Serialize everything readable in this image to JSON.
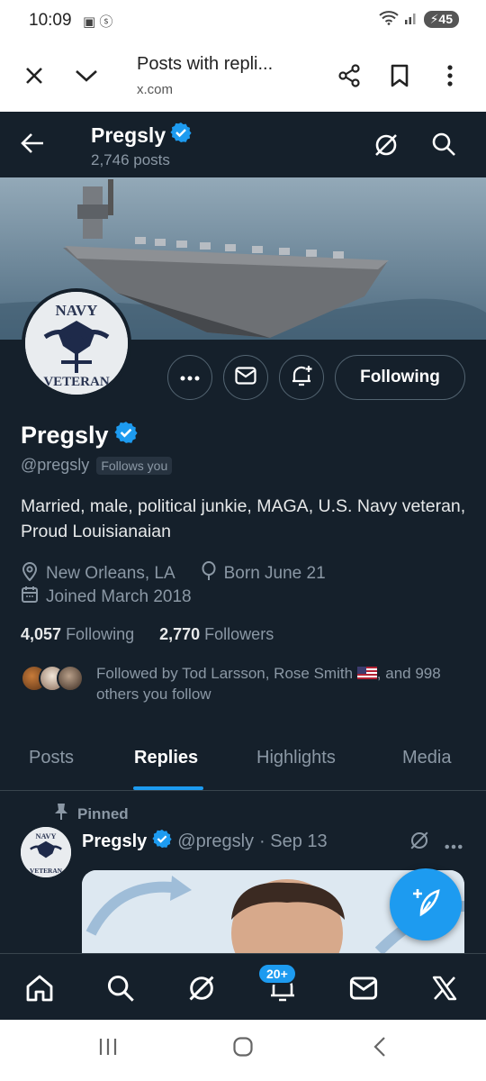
{
  "status_bar": {
    "time": "10:09",
    "battery": "45"
  },
  "browser": {
    "title": "Posts with repli...",
    "url": "x.com"
  },
  "header": {
    "name": "Pregsly",
    "posts_count": "2,746 posts"
  },
  "profile": {
    "name": "Pregsly",
    "handle": "@pregsly",
    "follows_you": "Follows you",
    "bio": "Married, male, political junkie, MAGA, U.S. Navy veteran, Proud Louisianaian",
    "location": "New Orleans, LA",
    "birthday": "Born June 21",
    "joined": "Joined March 2018",
    "following_count": "4,057",
    "following_label": "Following",
    "followers_count": "2,770",
    "followers_label": "Followers",
    "followed_by_prefix": "Followed by Tod Larsson, Rose Smith",
    "followed_by_suffix": ", and 998 others you follow",
    "follow_button": "Following",
    "avatar_text_top": "NAVY",
    "avatar_text_bottom": "VETERAN"
  },
  "tabs": [
    {
      "label": "Posts",
      "active": false
    },
    {
      "label": "Replies",
      "active": true
    },
    {
      "label": "Highlights",
      "active": false
    },
    {
      "label": "Media",
      "active": false
    }
  ],
  "post": {
    "pinned_label": "Pinned",
    "author": "Pregsly",
    "handle": "@pregsly",
    "date": "· Sep 13"
  },
  "bottom_nav": {
    "notifications_badge": "20+"
  },
  "colors": {
    "background": "#15202b",
    "accent": "#1d9bf0",
    "muted": "#8b98a5",
    "border": "#536471"
  },
  "icons": [
    "close-icon",
    "chevron-down-icon",
    "share-icon",
    "bookmark-icon",
    "more-vertical-icon",
    "back-arrow-icon",
    "verified-badge-icon",
    "grok-icon",
    "search-icon",
    "more-horizontal-icon",
    "mail-icon",
    "bell-plus-icon",
    "location-icon",
    "balloon-icon",
    "calendar-icon",
    "pin-icon",
    "compose-icon",
    "home-icon",
    "bell-icon",
    "x-logo-icon"
  ]
}
